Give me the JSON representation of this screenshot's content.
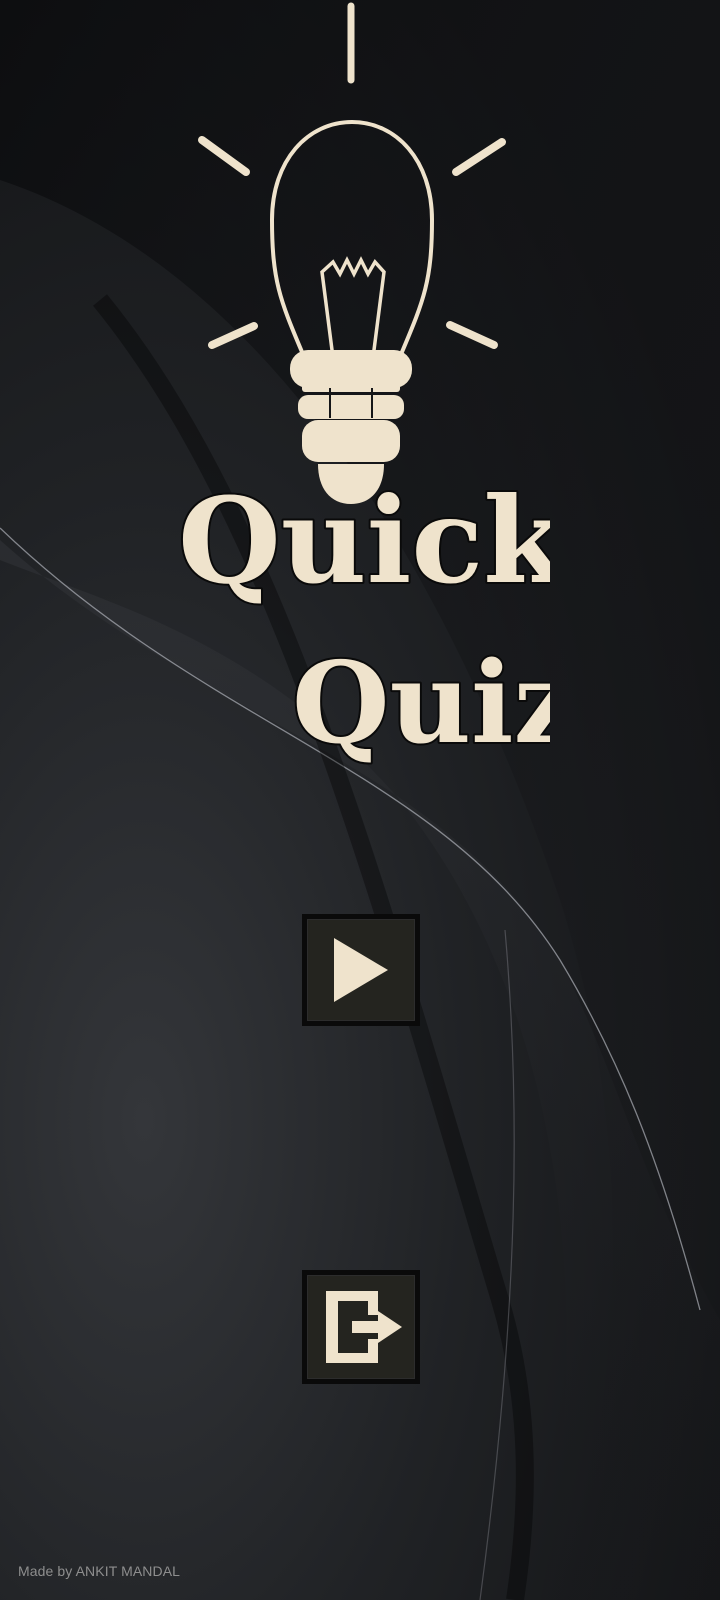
{
  "app": {
    "title_line1": "Quick",
    "title_line2": "Quiz"
  },
  "buttons": {
    "play_icon": "play-icon",
    "exit_icon": "exit-icon"
  },
  "footer": {
    "credit": "Made by ANKIT MANDAL"
  },
  "colors": {
    "background": "#151618",
    "accent_cream": "#efe3cc",
    "button_fill": "#24241f",
    "button_border": "#0a0a0a",
    "credit_text": "#8e8e8e"
  }
}
